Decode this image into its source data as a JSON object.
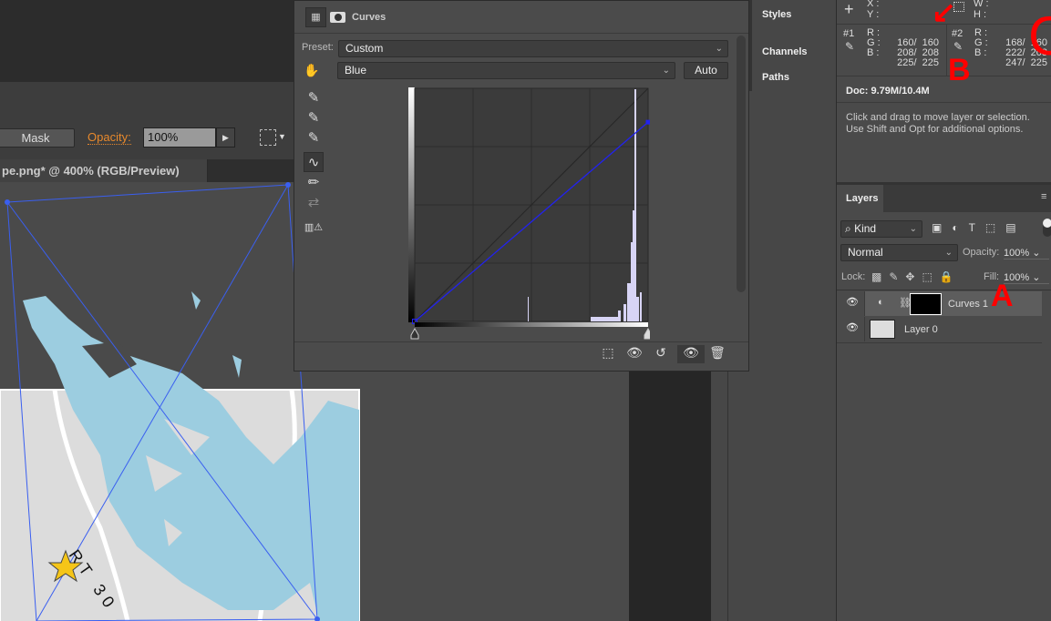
{
  "options_bar": {
    "mask_label": "Mask",
    "opacity_label": "Opacity:",
    "opacity_value": "100%"
  },
  "document_tab": {
    "title": "pe.png* @ 400% (RGB/Preview)"
  },
  "canvas": {
    "map_label": "RT 30"
  },
  "curves_panel": {
    "title": "Curves",
    "preset_label": "Preset:",
    "preset_value": "Custom",
    "channel_value": "Blue",
    "auto_label": "Auto",
    "curve_color": "#2222ee",
    "curve_points": [
      [
        0,
        0
      ],
      [
        255,
        218
      ]
    ]
  },
  "side_nav": {
    "items": [
      {
        "label": "Styles"
      },
      {
        "label": "Channels"
      },
      {
        "label": "Paths"
      }
    ]
  },
  "info_panel": {
    "x_label": "X :",
    "y_label": "Y :",
    "w_label": "W :",
    "h_label": "H :",
    "sampler1": {
      "id": "#1",
      "r": "160/  160",
      "g": "208/  208",
      "b": "225/  225"
    },
    "sampler2": {
      "id": "#2",
      "r": "168/  160",
      "g": "222/  208",
      "b": "247/  225"
    },
    "r_label": "R :",
    "g_label": "G :",
    "b_label": "B :",
    "doc": "Doc: 9.79M/10.4M",
    "hint1": "Click and drag to move layer or selection.",
    "hint2": "Use Shift and Opt for additional options."
  },
  "layers_panel": {
    "tab": "Layers",
    "filter": "Kind",
    "blend_mode": "Normal",
    "opacity_label": "Opacity:",
    "opacity_value": "100%",
    "lock_label": "Lock:",
    "fill_label": "Fill:",
    "fill_value": "100%",
    "layers": [
      {
        "name": "Curves 1",
        "selected": true
      },
      {
        "name": "Layer 0",
        "selected": false
      }
    ]
  },
  "annotations": {
    "a": "A",
    "b": "B",
    "c": "C"
  }
}
